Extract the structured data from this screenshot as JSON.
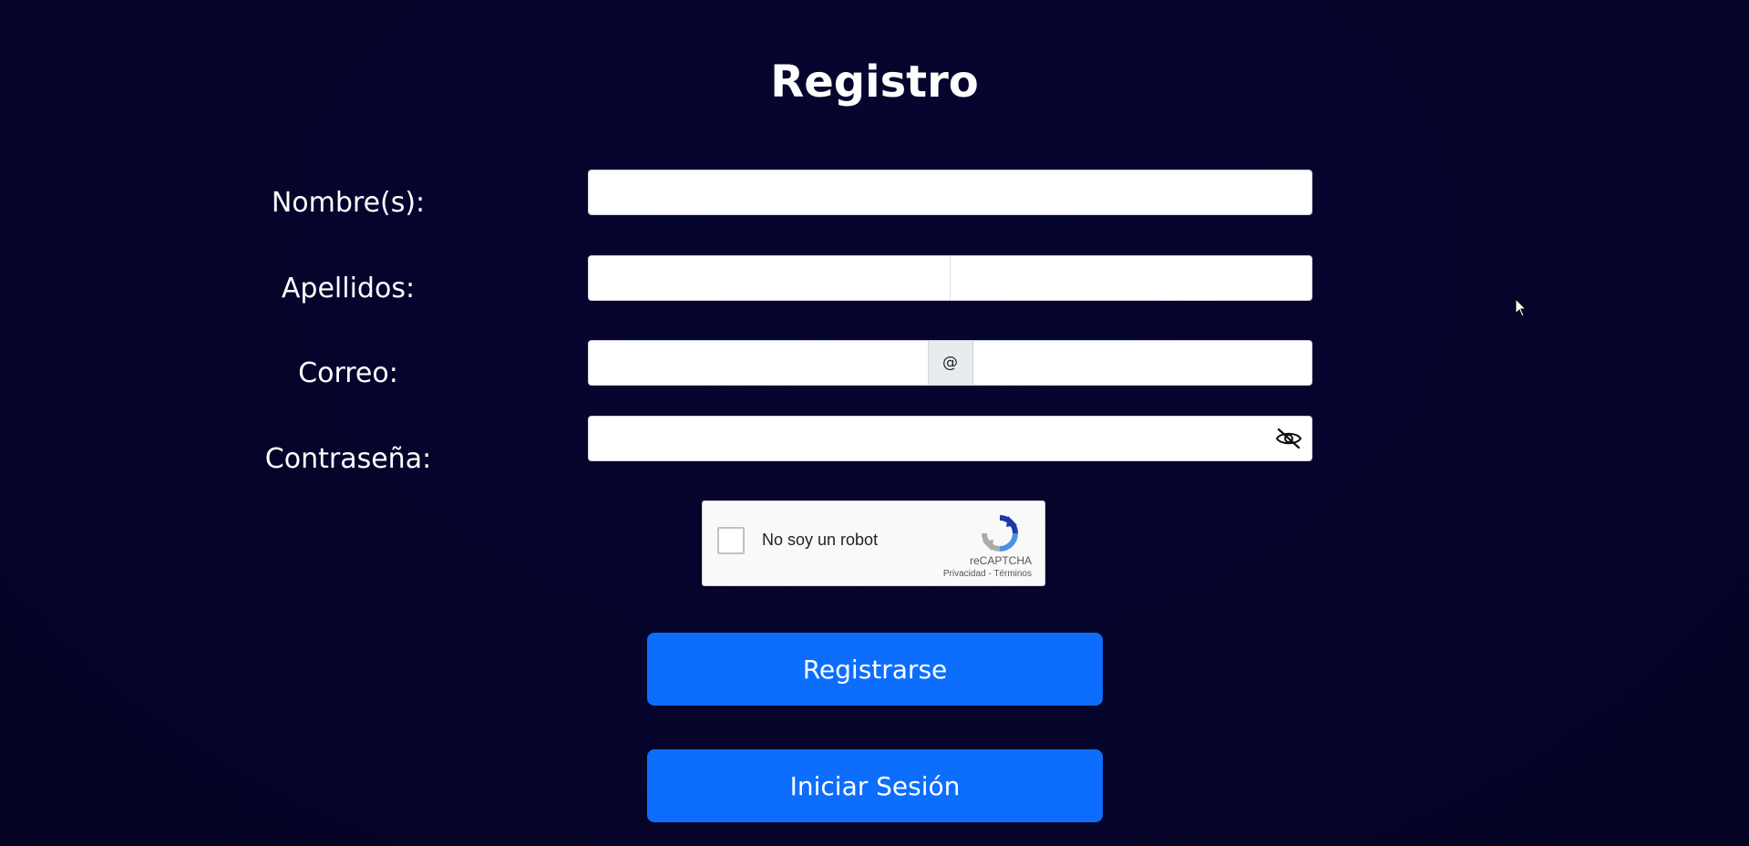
{
  "page": {
    "title": "Registro"
  },
  "form": {
    "nombre": {
      "label": "Nombre(s):",
      "value": "",
      "placeholder": ""
    },
    "apellidos": {
      "label": "Apellidos:",
      "first_value": "",
      "second_value": "",
      "placeholder": ""
    },
    "correo": {
      "label": "Correo:",
      "user_value": "",
      "at_symbol": "@",
      "domain_value": "",
      "placeholder": ""
    },
    "contrasena": {
      "label": "Contraseña:",
      "value": "",
      "placeholder": "",
      "toggle_icon": "eye-slash-icon"
    }
  },
  "captcha": {
    "checkbox_label": "No soy un robot",
    "brand": "reCAPTCHA",
    "privacy_link": "Privacidad",
    "separator": " - ",
    "terms_link": "Términos",
    "checked": false
  },
  "buttons": {
    "register_label": "Registrarse",
    "login_label": "Iniciar Sesión"
  },
  "colors": {
    "background": "#05042a",
    "button": "#0d6efd",
    "text": "#ffffff"
  }
}
